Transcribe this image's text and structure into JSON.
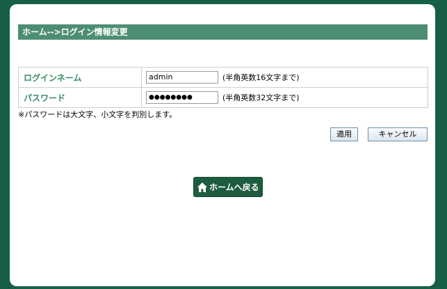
{
  "header": {
    "title": "ホーム-->ログイン情報変更"
  },
  "form": {
    "login_name": {
      "label": "ログインネーム",
      "value": "admin",
      "hint": "(半角英数16文字まで)"
    },
    "password": {
      "label": "パスワード",
      "value": "●●●●●●●●",
      "hint": "(半角英数32文字まで)"
    },
    "note": "※パスワードは大文字、小文字を判別します。"
  },
  "buttons": {
    "apply": "適用",
    "cancel": "キャンセル",
    "home": "ホームへ戻る"
  },
  "icons": {
    "home": "home-icon"
  },
  "colors": {
    "background": "#175f44",
    "title_bar": "#4d8e73",
    "label_text": "#3d8a66",
    "home_button": "#1e5c40"
  }
}
